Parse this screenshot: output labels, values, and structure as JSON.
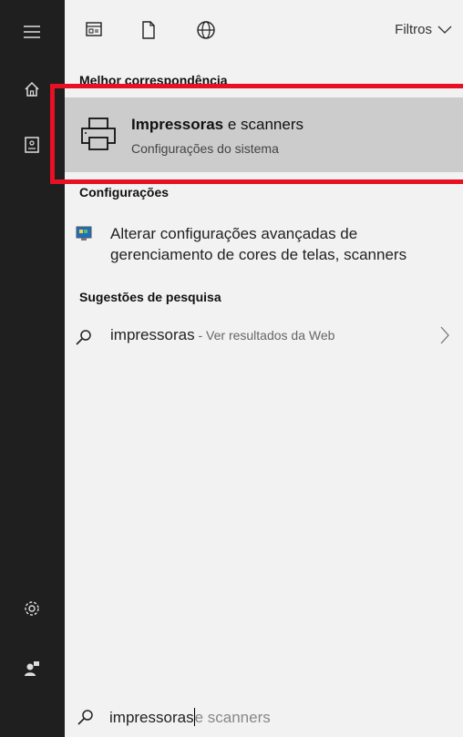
{
  "rail": {
    "icons": [
      "hamburger-menu-icon",
      "home-icon",
      "notebook-icon",
      "settings-gear-icon",
      "feedback-icon"
    ]
  },
  "topbar": {
    "icons": [
      "apps-filter-icon",
      "documents-filter-icon",
      "web-filter-icon"
    ],
    "filters_label": "Filtros"
  },
  "best_match": {
    "section_title": "Melhor correspondência",
    "title_bold": "Impressoras",
    "title_rest": " e scanners",
    "subtitle": "Configurações do sistema"
  },
  "settings_section": {
    "title": "Configurações",
    "item_text": "Alterar configurações avançadas de gerenciamento de cores de telas, scanners"
  },
  "search_suggestions": {
    "title": "Sugestões de pesquisa",
    "query": "impressoras",
    "hint": " - Ver resultados da Web"
  },
  "search": {
    "typed": "impressoras",
    "completion": "e scanners"
  },
  "colors": {
    "highlight": "#e81123",
    "rail_bg": "#1f1f1f",
    "selection_bg": "#cccccc"
  }
}
